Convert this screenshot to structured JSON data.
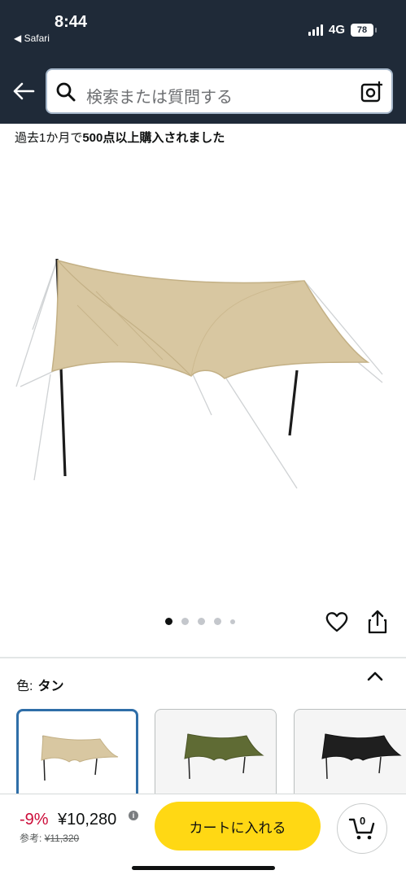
{
  "status_bar": {
    "time": "8:44",
    "back_app": "◀ Safari",
    "network": "4G",
    "battery": "78"
  },
  "header": {
    "search_placeholder": "検索または質問する",
    "theme_color": "#1f2a38"
  },
  "product": {
    "purchase_note_prefix": "過去1か月で",
    "purchase_note_bold": "500点以上購入されました",
    "image_count": 5,
    "active_image": 1,
    "color_label": "色:",
    "color_value": "タン",
    "color_options": [
      "tan",
      "olive",
      "black"
    ],
    "selected_color": "tan"
  },
  "buy_bar": {
    "discount": "-9%",
    "price": "¥10,280",
    "ref_label": "参考:",
    "ref_price": "¥11,320",
    "cart_button": "カートに入れる",
    "cart_count": "0",
    "button_color": "#ffd814",
    "discount_color": "#cc0c39"
  }
}
